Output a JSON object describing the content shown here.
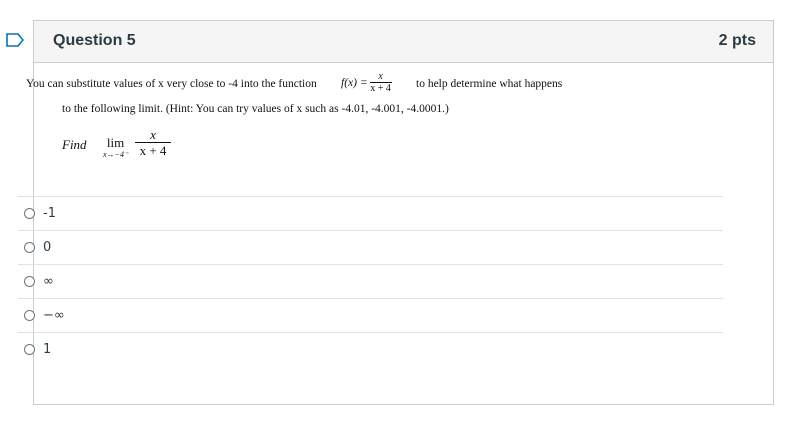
{
  "question": {
    "title": "Question 5",
    "points": "2 pts"
  },
  "prompt": {
    "line1_start": "You can substitute values of x very close to -4 into the function",
    "fn_name": "f(x) =",
    "fn_numerator": "x",
    "fn_denominator": "x + 4",
    "line1_end": "to help determine what happens",
    "line2": "to the following limit. (Hint: You can try values of x such as -4.01, -4.001, -4.0001.)"
  },
  "limit": {
    "find_label": "Find",
    "lim_word": "lim",
    "lim_sub": "x→−4⁻",
    "numerator": "x",
    "denominator": "x + 4"
  },
  "answers": [
    {
      "label": "-1",
      "selected": false
    },
    {
      "label": "0",
      "selected": false
    },
    {
      "label": "∞",
      "selected": false
    },
    {
      "label": "−∞",
      "selected": false
    },
    {
      "label": "1",
      "selected": false
    }
  ],
  "icons": {
    "flag": "flag-icon",
    "radio": "radio-button-icon"
  },
  "colors": {
    "accent": "#0374b5",
    "header_bg": "#f5f5f5",
    "border": "#c7cdd1"
  }
}
